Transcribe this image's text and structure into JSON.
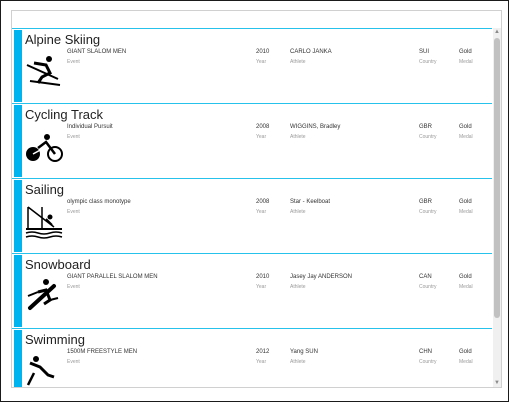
{
  "rows": [
    {
      "sport": "Alpine Skiing",
      "event": "GIANT SLALOM MEN",
      "event_label": "Event",
      "year": "2010",
      "year_label": "Year",
      "athlete": "CARLO JANKA",
      "athlete_label": "Athlete",
      "country": "SUI",
      "country_label": "Country",
      "medal": "Gold",
      "medal_label": "Medal",
      "icon": "alpine-skiing-icon"
    },
    {
      "sport": "Cycling Track",
      "event": "Individual Pursuit",
      "event_label": "Event",
      "year": "2008",
      "year_label": "Year",
      "athlete": "WIGGINS, Bradley",
      "athlete_label": "Athlete",
      "country": "GBR",
      "country_label": "Country",
      "medal": "Gold",
      "medal_label": "Medal",
      "icon": "cycling-track-icon"
    },
    {
      "sport": "Sailing",
      "event": "olympic class monotype",
      "event_label": "Event",
      "year": "2008",
      "year_label": "Year",
      "athlete": "Star - Keelboat",
      "athlete_label": "Athlete",
      "country": "GBR",
      "country_label": "Country",
      "medal": "Gold",
      "medal_label": "Medal",
      "icon": "sailing-icon"
    },
    {
      "sport": "Snowboard",
      "event": "GIANT PARALLEL SLALOM MEN",
      "event_label": "Event",
      "year": "2010",
      "year_label": "Year",
      "athlete": "Jasey Jay ANDERSON",
      "athlete_label": "Athlete",
      "country": "CAN",
      "country_label": "Country",
      "medal": "Gold",
      "medal_label": "Medal",
      "icon": "snowboard-icon"
    },
    {
      "sport": "Swimming",
      "event": "1500M FREESTYLE MEN",
      "event_label": "Event",
      "year": "2012",
      "year_label": "Year",
      "athlete": "Yang SUN",
      "athlete_label": "Athlete",
      "country": "CHN",
      "country_label": "Country",
      "medal": "Gold",
      "medal_label": "Medal",
      "icon": "swimming-icon"
    }
  ],
  "colors": {
    "accent": "#00b4f0",
    "divider": "#27c2ec"
  }
}
